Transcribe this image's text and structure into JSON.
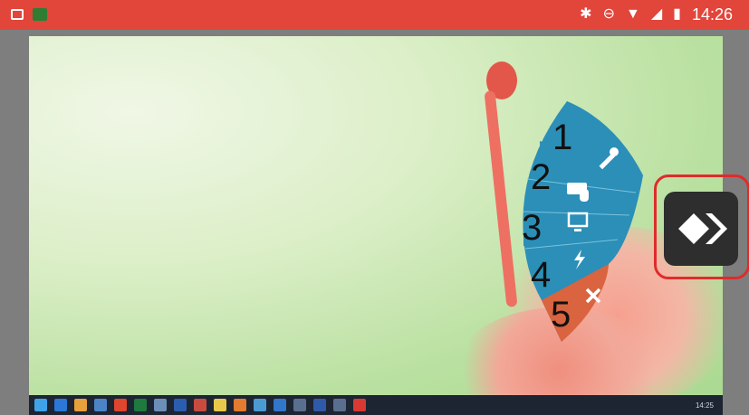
{
  "status_bar": {
    "time": "14:26",
    "icons": [
      "image-icon",
      "app-icon",
      "bluetooth-icon",
      "do-not-disturb-icon",
      "wifi-icon",
      "signal-icon",
      "battery-icon"
    ],
    "color": "#e2453a"
  },
  "radial_menu": {
    "items": [
      {
        "number": "1",
        "icon": "wrench-icon",
        "color": "#2b8fb8"
      },
      {
        "number": "2",
        "icon": "keyboard-mouse-icon",
        "color": "#2b8fb8"
      },
      {
        "number": "3",
        "icon": "monitor-icon",
        "color": "#2b8fb8"
      },
      {
        "number": "4",
        "icon": "lightning-icon",
        "color": "#2b8fb8"
      },
      {
        "number": "5",
        "icon": "close-icon",
        "color": "#d9643f"
      }
    ]
  },
  "side_handle": {
    "icon": "anydesk-logo-icon",
    "highlight_color": "#e02b2b"
  },
  "taskbar": {
    "clock": "14:25"
  }
}
